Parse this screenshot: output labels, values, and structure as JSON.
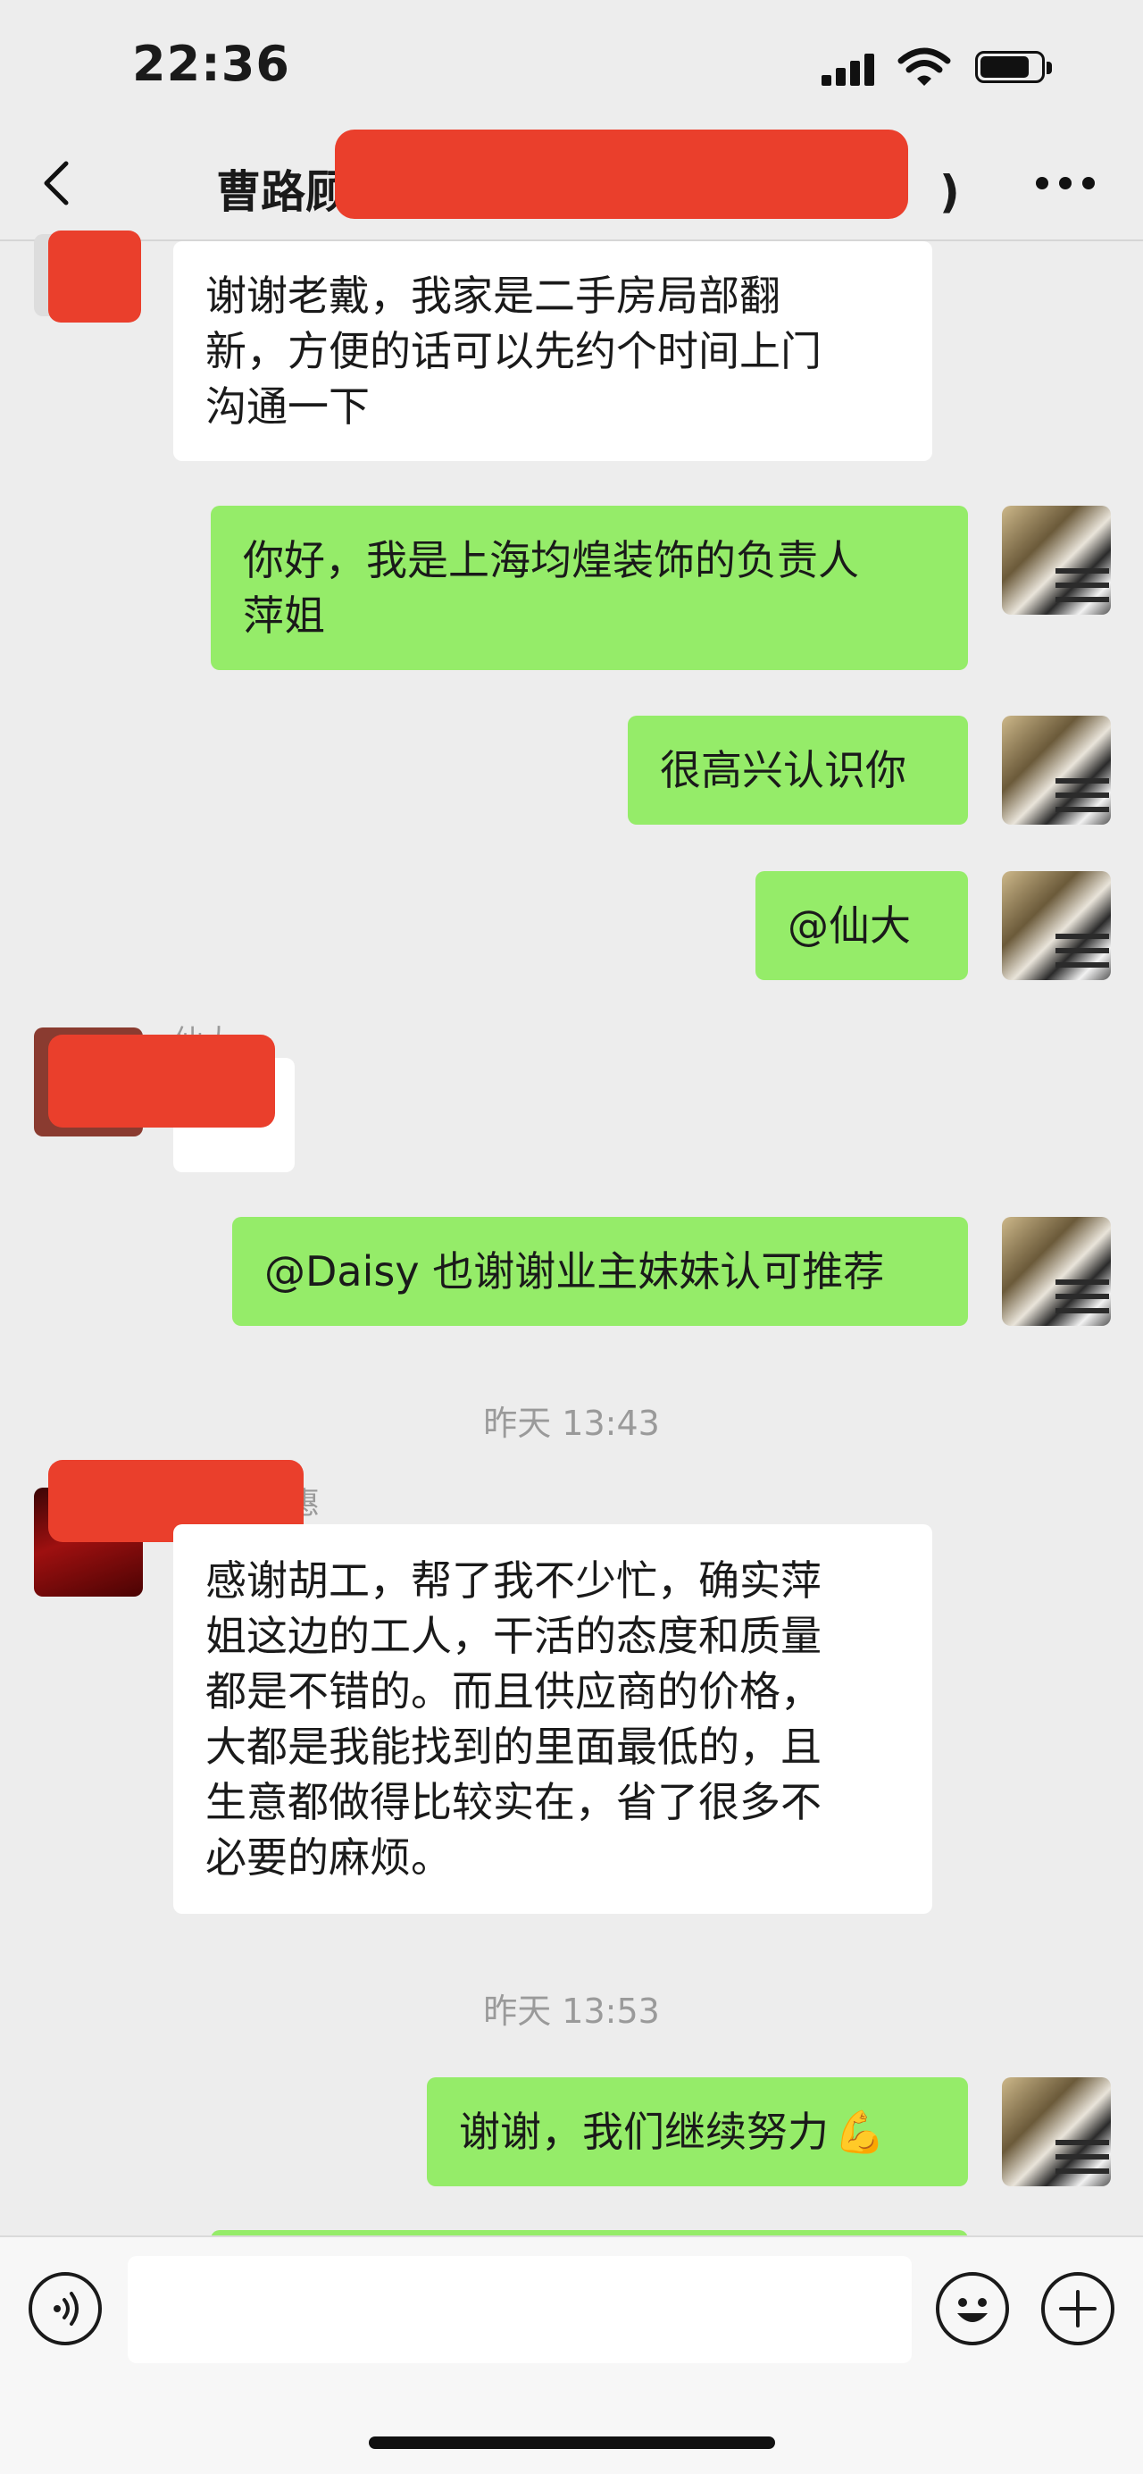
{
  "status_bar": {
    "time": "22:36"
  },
  "header": {
    "title_prefix": "曹路顾",
    "title_suffix": ")"
  },
  "messages": [
    {
      "text": "谢谢老戴，我家是二手房局部翻\n新，方便的话可以先约个时间上门\n沟通一下"
    },
    {
      "text": "你好，我是上海均煌装饰的负责人\n萍姐"
    },
    {
      "text": "很高兴认识你"
    },
    {
      "text": "@仙大"
    },
    {
      "sender": "仙大"
    },
    {
      "text": "@Daisy 也谢谢业主妹妹认可推荐"
    },
    {
      "timestamp": "昨天 13:43"
    },
    {
      "sender": "惠",
      "text": "感谢胡工，帮了我不少忙，确实萍\n姐这边的工人，干活的态度和质量\n都是不错的。而且供应商的价格，\n大都是我能找到的里面最低的，且\n生意都做得比较实在，省了很多不\n必要的麻烦。"
    },
    {
      "timestamp": "昨天 13:53"
    },
    {
      "text": "谢谢，我们继续努力",
      "emoji": "💪"
    }
  ],
  "input": {
    "placeholder": ""
  },
  "icons": {
    "back": "chevron-left-icon",
    "more": "more-dots-icon",
    "voice": "voice-icon",
    "emoji": "emoji-icon",
    "add": "plus-icon"
  },
  "colors": {
    "background": "#ededed",
    "outgoing_bubble": "#95ec69",
    "incoming_bubble": "#ffffff",
    "redaction": "#ea3f2c"
  }
}
